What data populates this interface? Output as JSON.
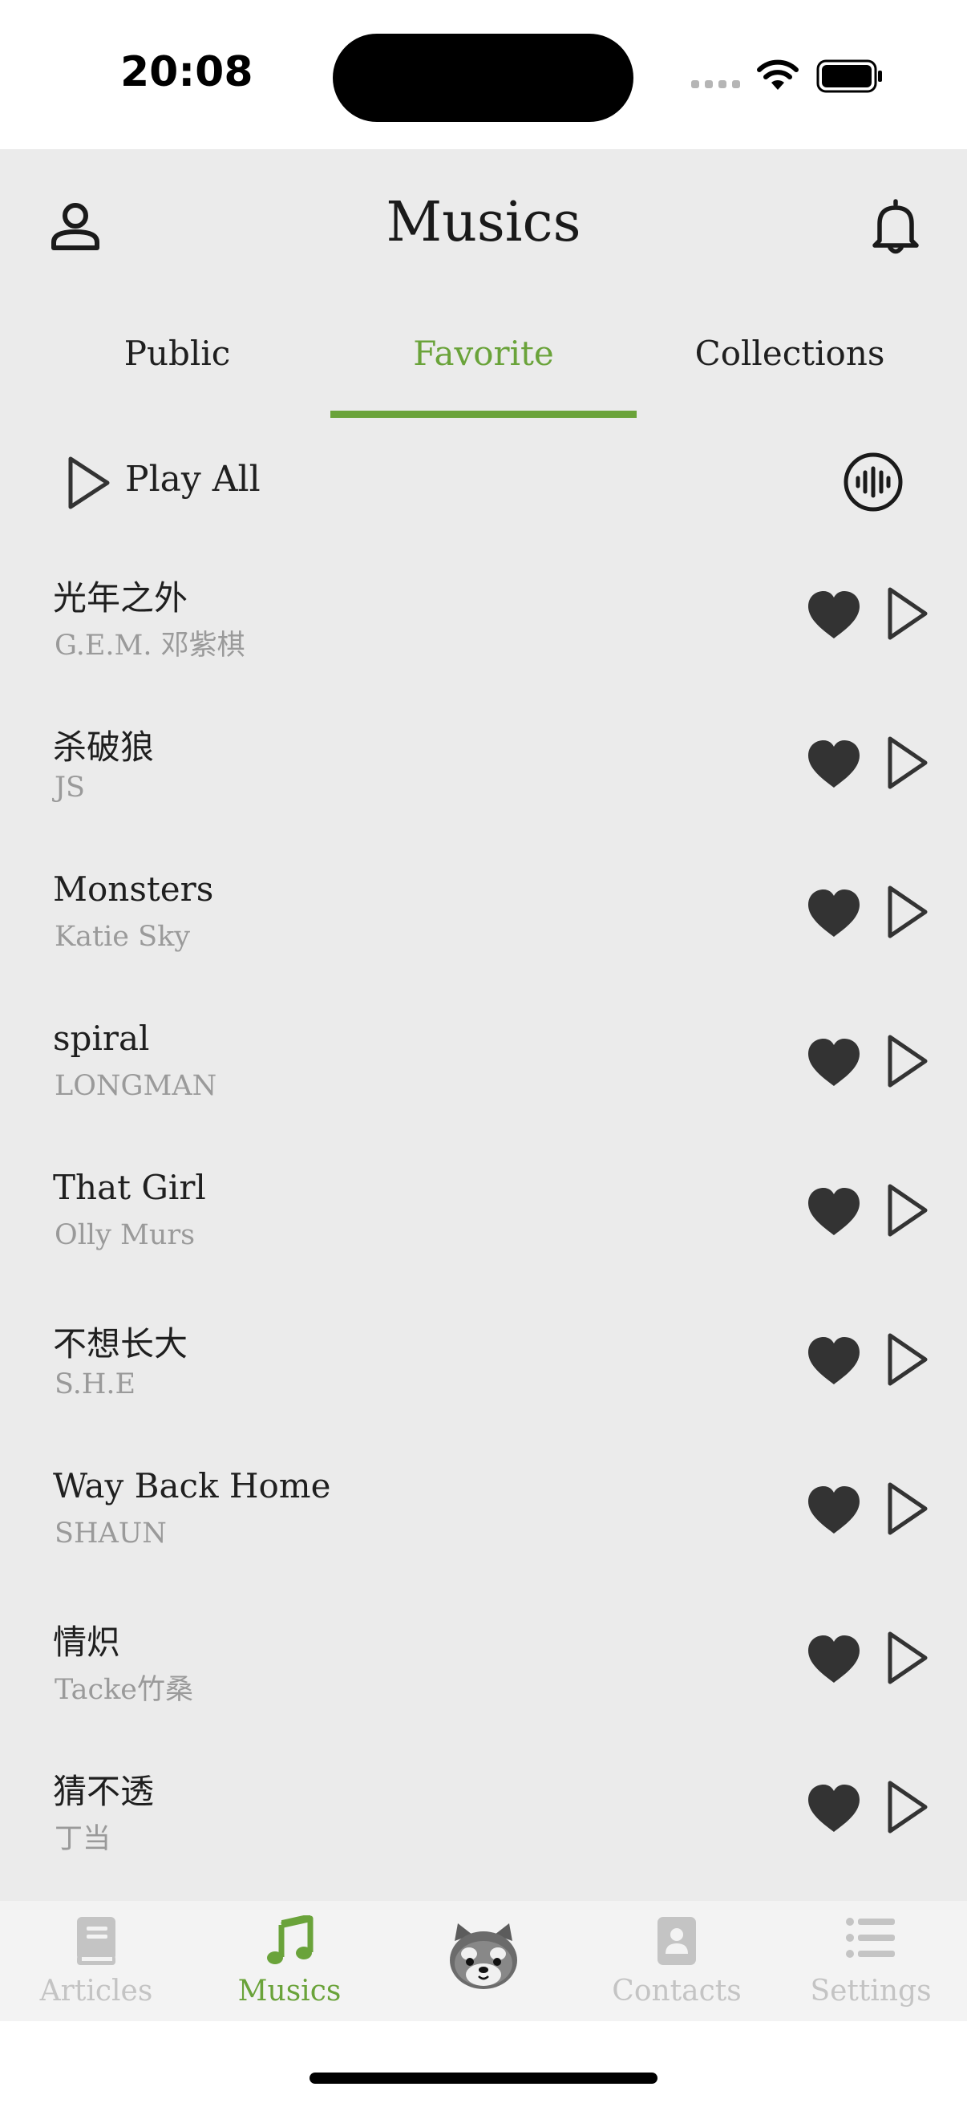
{
  "status_bar": {
    "time": "20:08"
  },
  "header": {
    "title": "Musics"
  },
  "tabs": [
    {
      "label": "Public",
      "active": false
    },
    {
      "label": "Favorite",
      "active": true
    },
    {
      "label": "Collections",
      "active": false
    }
  ],
  "play_all": {
    "label": "Play All"
  },
  "songs": [
    {
      "title": "光年之外",
      "artist": "G.E.M. 邓紫棋"
    },
    {
      "title": "杀破狼",
      "artist": "JS"
    },
    {
      "title": "Monsters",
      "artist": "Katie Sky"
    },
    {
      "title": "spiral",
      "artist": "LONGMAN"
    },
    {
      "title": "That Girl",
      "artist": "Olly Murs"
    },
    {
      "title": "不想长大",
      "artist": "S.H.E"
    },
    {
      "title": "Way Back Home",
      "artist": "SHAUN"
    },
    {
      "title": "情炽",
      "artist": "Tacke竹桑"
    },
    {
      "title": "猜不透",
      "artist": "丁当"
    }
  ],
  "bottom_nav": [
    {
      "label": "Articles",
      "icon": "book-icon",
      "active": false
    },
    {
      "label": "Musics",
      "icon": "music-note-icon",
      "active": true
    },
    {
      "label": "",
      "icon": "red-panda-icon",
      "active": false
    },
    {
      "label": "Contacts",
      "icon": "contacts-icon",
      "active": false
    },
    {
      "label": "Settings",
      "icon": "list-icon",
      "active": false
    }
  ],
  "colors": {
    "accent": "#6aa33a",
    "background": "#ebebeb",
    "secondary_text": "#9a9a9a",
    "inactive_nav": "#c4c4c4"
  }
}
